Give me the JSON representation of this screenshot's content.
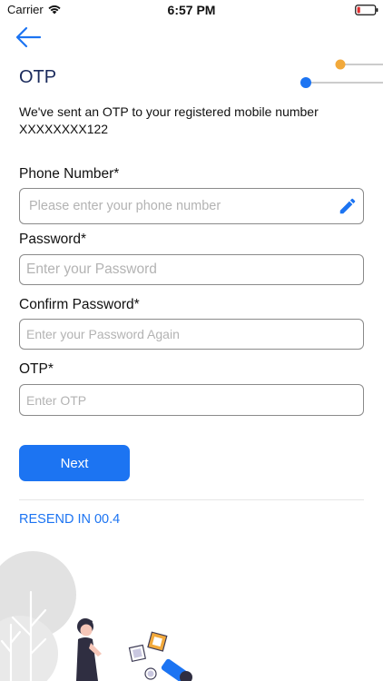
{
  "status_bar": {
    "carrier": "Carrier",
    "time": "6:57 PM",
    "icons": [
      "wifi-icon",
      "battery-low-icon"
    ]
  },
  "header": {
    "back_icon": "arrow-left-icon",
    "title": "OTP"
  },
  "stepper": {
    "steps": [
      "step-1-indicator",
      "step-2-indicator"
    ],
    "colors": {
      "step_1": "#f2a93b",
      "step_2": "#1c74f2",
      "line": "#9a9a9a"
    }
  },
  "message": {
    "line1": "We've sent an OTP to your registered mobile number",
    "line2": "XXXXXXXX122"
  },
  "form": {
    "phone": {
      "label": "Phone Number*",
      "placeholder": "Please enter your phone number",
      "value": "",
      "edit_icon": "pencil-icon"
    },
    "password": {
      "label": "Password*",
      "placeholder": "Enter your Password",
      "value": ""
    },
    "confirm_password": {
      "label": "Confirm Password*",
      "placeholder": "Enter your Password Again",
      "value": ""
    },
    "otp": {
      "label": "OTP*",
      "placeholder": "Enter OTP",
      "value": ""
    }
  },
  "actions": {
    "next_label": "Next",
    "resend_label": "RESEND IN 00.4"
  },
  "colors": {
    "accent": "#1c74f2",
    "title": "#1a2a5c",
    "border": "#8a8a8a",
    "placeholder": "#b3b3b3"
  }
}
